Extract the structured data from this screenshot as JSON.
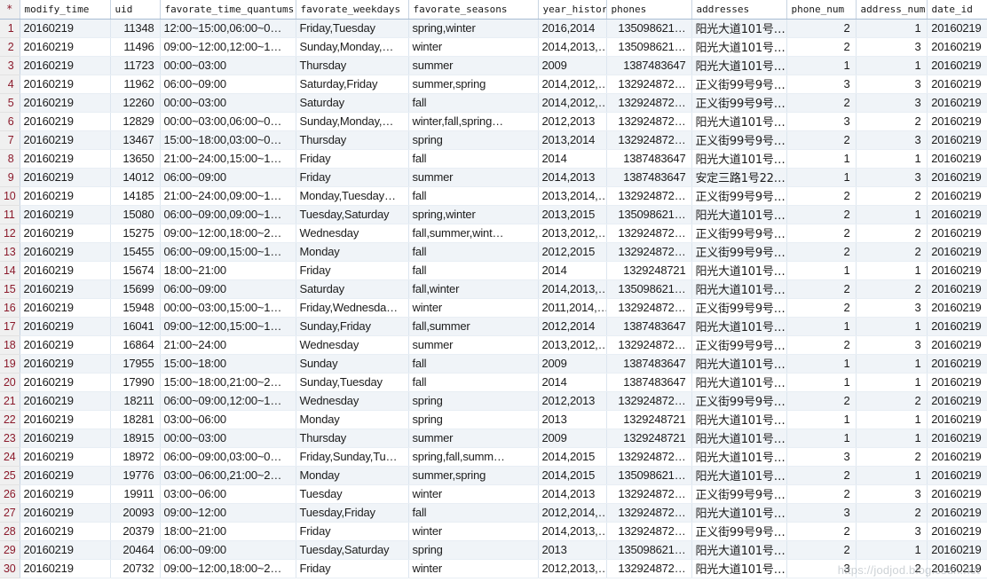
{
  "grid": {
    "row_number_header": "*",
    "watermark": "https://jodjod.blog.csdn.net",
    "columns": [
      "modify_time",
      "uid",
      "favorate_time_quantums",
      "favorate_weekdays",
      "favorate_seasons",
      "year_history",
      "phones",
      "addresses",
      "phone_num",
      "address_num",
      "date_id"
    ],
    "rows": [
      {
        "n": "1",
        "modify_time": "20160219",
        "uid": "11348",
        "favorate_time_quantums": "12:00~15:00,06:00~0…",
        "favorate_weekdays": "Friday,Tuesday",
        "favorate_seasons": "spring,winter",
        "year_history": "2016,2014",
        "phones": "135098621…",
        "addresses": "阳光大道101号…",
        "phone_num": "2",
        "address_num": "1",
        "date_id": "20160219"
      },
      {
        "n": "2",
        "modify_time": "20160219",
        "uid": "11496",
        "favorate_time_quantums": "09:00~12:00,12:00~1…",
        "favorate_weekdays": "Sunday,Monday,…",
        "favorate_seasons": "winter",
        "year_history": "2014,2013,…",
        "phones": "135098621…",
        "addresses": "阳光大道101号…",
        "phone_num": "2",
        "address_num": "3",
        "date_id": "20160219"
      },
      {
        "n": "3",
        "modify_time": "20160219",
        "uid": "11723",
        "favorate_time_quantums": "00:00~03:00",
        "favorate_weekdays": "Thursday",
        "favorate_seasons": "summer",
        "year_history": "2009",
        "phones": "1387483647",
        "addresses": "阳光大道101号…",
        "phone_num": "1",
        "address_num": "1",
        "date_id": "20160219"
      },
      {
        "n": "4",
        "modify_time": "20160219",
        "uid": "11962",
        "favorate_time_quantums": "06:00~09:00",
        "favorate_weekdays": "Saturday,Friday",
        "favorate_seasons": "summer,spring",
        "year_history": "2014,2012,…",
        "phones": "132924872…",
        "addresses": "正义街99号9号…",
        "phone_num": "3",
        "address_num": "3",
        "date_id": "20160219"
      },
      {
        "n": "5",
        "modify_time": "20160219",
        "uid": "12260",
        "favorate_time_quantums": "00:00~03:00",
        "favorate_weekdays": "Saturday",
        "favorate_seasons": "fall",
        "year_history": "2014,2012,…",
        "phones": "132924872…",
        "addresses": "正义街99号9号…",
        "phone_num": "2",
        "address_num": "3",
        "date_id": "20160219"
      },
      {
        "n": "6",
        "modify_time": "20160219",
        "uid": "12829",
        "favorate_time_quantums": "00:00~03:00,06:00~0…",
        "favorate_weekdays": "Sunday,Monday,…",
        "favorate_seasons": "winter,fall,spring…",
        "year_history": "2012,2013",
        "phones": "132924872…",
        "addresses": "阳光大道101号…",
        "phone_num": "3",
        "address_num": "2",
        "date_id": "20160219"
      },
      {
        "n": "7",
        "modify_time": "20160219",
        "uid": "13467",
        "favorate_time_quantums": "15:00~18:00,03:00~0…",
        "favorate_weekdays": "Thursday",
        "favorate_seasons": "spring",
        "year_history": "2013,2014",
        "phones": "132924872…",
        "addresses": "正义街99号9号…",
        "phone_num": "2",
        "address_num": "3",
        "date_id": "20160219"
      },
      {
        "n": "8",
        "modify_time": "20160219",
        "uid": "13650",
        "favorate_time_quantums": "21:00~24:00,15:00~1…",
        "favorate_weekdays": "Friday",
        "favorate_seasons": "fall",
        "year_history": "2014",
        "phones": "1387483647",
        "addresses": "阳光大道101号…",
        "phone_num": "1",
        "address_num": "1",
        "date_id": "20160219"
      },
      {
        "n": "9",
        "modify_time": "20160219",
        "uid": "14012",
        "favorate_time_quantums": "06:00~09:00",
        "favorate_weekdays": "Friday",
        "favorate_seasons": "summer",
        "year_history": "2014,2013",
        "phones": "1387483647",
        "addresses": "安定三路1号22…",
        "phone_num": "1",
        "address_num": "3",
        "date_id": "20160219"
      },
      {
        "n": "10",
        "modify_time": "20160219",
        "uid": "14185",
        "favorate_time_quantums": "21:00~24:00,09:00~1…",
        "favorate_weekdays": "Monday,Tuesday…",
        "favorate_seasons": "fall",
        "year_history": "2013,2014,…",
        "phones": "132924872…",
        "addresses": "正义街99号9号…",
        "phone_num": "2",
        "address_num": "2",
        "date_id": "20160219"
      },
      {
        "n": "11",
        "modify_time": "20160219",
        "uid": "15080",
        "favorate_time_quantums": "06:00~09:00,09:00~1…",
        "favorate_weekdays": "Tuesday,Saturday",
        "favorate_seasons": "spring,winter",
        "year_history": "2013,2015",
        "phones": "135098621…",
        "addresses": "阳光大道101号…",
        "phone_num": "2",
        "address_num": "1",
        "date_id": "20160219"
      },
      {
        "n": "12",
        "modify_time": "20160219",
        "uid": "15275",
        "favorate_time_quantums": "09:00~12:00,18:00~2…",
        "favorate_weekdays": "Wednesday",
        "favorate_seasons": "fall,summer,wint…",
        "year_history": "2013,2012,…",
        "phones": "132924872…",
        "addresses": "正义街99号9号…",
        "phone_num": "2",
        "address_num": "2",
        "date_id": "20160219"
      },
      {
        "n": "13",
        "modify_time": "20160219",
        "uid": "15455",
        "favorate_time_quantums": "06:00~09:00,15:00~1…",
        "favorate_weekdays": "Monday",
        "favorate_seasons": "fall",
        "year_history": "2012,2015",
        "phones": "132924872…",
        "addresses": "正义街99号9号…",
        "phone_num": "2",
        "address_num": "2",
        "date_id": "20160219"
      },
      {
        "n": "14",
        "modify_time": "20160219",
        "uid": "15674",
        "favorate_time_quantums": "18:00~21:00",
        "favorate_weekdays": "Friday",
        "favorate_seasons": "fall",
        "year_history": "2014",
        "phones": "1329248721",
        "addresses": "阳光大道101号…",
        "phone_num": "1",
        "address_num": "1",
        "date_id": "20160219"
      },
      {
        "n": "15",
        "modify_time": "20160219",
        "uid": "15699",
        "favorate_time_quantums": "06:00~09:00",
        "favorate_weekdays": "Saturday",
        "favorate_seasons": "fall,winter",
        "year_history": "2014,2013,…",
        "phones": "135098621…",
        "addresses": "阳光大道101号…",
        "phone_num": "2",
        "address_num": "2",
        "date_id": "20160219"
      },
      {
        "n": "16",
        "modify_time": "20160219",
        "uid": "15948",
        "favorate_time_quantums": "00:00~03:00,15:00~1…",
        "favorate_weekdays": "Friday,Wednesda…",
        "favorate_seasons": "winter",
        "year_history": "2011,2014,…",
        "phones": "132924872…",
        "addresses": "正义街99号9号…",
        "phone_num": "2",
        "address_num": "3",
        "date_id": "20160219"
      },
      {
        "n": "17",
        "modify_time": "20160219",
        "uid": "16041",
        "favorate_time_quantums": "09:00~12:00,15:00~1…",
        "favorate_weekdays": "Sunday,Friday",
        "favorate_seasons": "fall,summer",
        "year_history": "2012,2014",
        "phones": "1387483647",
        "addresses": "阳光大道101号…",
        "phone_num": "1",
        "address_num": "1",
        "date_id": "20160219"
      },
      {
        "n": "18",
        "modify_time": "20160219",
        "uid": "16864",
        "favorate_time_quantums": "21:00~24:00",
        "favorate_weekdays": "Wednesday",
        "favorate_seasons": "summer",
        "year_history": "2013,2012,…",
        "phones": "132924872…",
        "addresses": "正义街99号9号…",
        "phone_num": "2",
        "address_num": "3",
        "date_id": "20160219"
      },
      {
        "n": "19",
        "modify_time": "20160219",
        "uid": "17955",
        "favorate_time_quantums": "15:00~18:00",
        "favorate_weekdays": "Sunday",
        "favorate_seasons": "fall",
        "year_history": "2009",
        "phones": "1387483647",
        "addresses": "阳光大道101号…",
        "phone_num": "1",
        "address_num": "1",
        "date_id": "20160219"
      },
      {
        "n": "20",
        "modify_time": "20160219",
        "uid": "17990",
        "favorate_time_quantums": "15:00~18:00,21:00~2…",
        "favorate_weekdays": "Sunday,Tuesday",
        "favorate_seasons": "fall",
        "year_history": "2014",
        "phones": "1387483647",
        "addresses": "阳光大道101号…",
        "phone_num": "1",
        "address_num": "1",
        "date_id": "20160219"
      },
      {
        "n": "21",
        "modify_time": "20160219",
        "uid": "18211",
        "favorate_time_quantums": "06:00~09:00,12:00~1…",
        "favorate_weekdays": "Wednesday",
        "favorate_seasons": "spring",
        "year_history": "2012,2013",
        "phones": "132924872…",
        "addresses": "正义街99号9号…",
        "phone_num": "2",
        "address_num": "2",
        "date_id": "20160219"
      },
      {
        "n": "22",
        "modify_time": "20160219",
        "uid": "18281",
        "favorate_time_quantums": "03:00~06:00",
        "favorate_weekdays": "Monday",
        "favorate_seasons": "spring",
        "year_history": "2013",
        "phones": "1329248721",
        "addresses": "阳光大道101号…",
        "phone_num": "1",
        "address_num": "1",
        "date_id": "20160219"
      },
      {
        "n": "23",
        "modify_time": "20160219",
        "uid": "18915",
        "favorate_time_quantums": "00:00~03:00",
        "favorate_weekdays": "Thursday",
        "favorate_seasons": "summer",
        "year_history": "2009",
        "phones": "1329248721",
        "addresses": "阳光大道101号…",
        "phone_num": "1",
        "address_num": "1",
        "date_id": "20160219"
      },
      {
        "n": "24",
        "modify_time": "20160219",
        "uid": "18972",
        "favorate_time_quantums": "06:00~09:00,03:00~0…",
        "favorate_weekdays": "Friday,Sunday,Tu…",
        "favorate_seasons": "spring,fall,summ…",
        "year_history": "2014,2015",
        "phones": "132924872…",
        "addresses": "阳光大道101号…",
        "phone_num": "3",
        "address_num": "2",
        "date_id": "20160219"
      },
      {
        "n": "25",
        "modify_time": "20160219",
        "uid": "19776",
        "favorate_time_quantums": "03:00~06:00,21:00~2…",
        "favorate_weekdays": "Monday",
        "favorate_seasons": "summer,spring",
        "year_history": "2014,2015",
        "phones": "135098621…",
        "addresses": "阳光大道101号…",
        "phone_num": "2",
        "address_num": "1",
        "date_id": "20160219"
      },
      {
        "n": "26",
        "modify_time": "20160219",
        "uid": "19911",
        "favorate_time_quantums": "03:00~06:00",
        "favorate_weekdays": "Tuesday",
        "favorate_seasons": "winter",
        "year_history": "2014,2013",
        "phones": "132924872…",
        "addresses": "正义街99号9号…",
        "phone_num": "2",
        "address_num": "3",
        "date_id": "20160219"
      },
      {
        "n": "27",
        "modify_time": "20160219",
        "uid": "20093",
        "favorate_time_quantums": "09:00~12:00",
        "favorate_weekdays": "Tuesday,Friday",
        "favorate_seasons": "fall",
        "year_history": "2012,2014,…",
        "phones": "132924872…",
        "addresses": "阳光大道101号…",
        "phone_num": "3",
        "address_num": "2",
        "date_id": "20160219"
      },
      {
        "n": "28",
        "modify_time": "20160219",
        "uid": "20379",
        "favorate_time_quantums": "18:00~21:00",
        "favorate_weekdays": "Friday",
        "favorate_seasons": "winter",
        "year_history": "2014,2013,…",
        "phones": "132924872…",
        "addresses": "正义街99号9号…",
        "phone_num": "2",
        "address_num": "3",
        "date_id": "20160219"
      },
      {
        "n": "29",
        "modify_time": "20160219",
        "uid": "20464",
        "favorate_time_quantums": "06:00~09:00",
        "favorate_weekdays": "Tuesday,Saturday",
        "favorate_seasons": "spring",
        "year_history": "2013",
        "phones": "135098621…",
        "addresses": "阳光大道101号…",
        "phone_num": "2",
        "address_num": "1",
        "date_id": "20160219"
      },
      {
        "n": "30",
        "modify_time": "20160219",
        "uid": "20732",
        "favorate_time_quantums": "09:00~12:00,18:00~2…",
        "favorate_weekdays": "Friday",
        "favorate_seasons": "winter",
        "year_history": "2012,2013,…",
        "phones": "132924872…",
        "addresses": "阳光大道101号…",
        "phone_num": "3",
        "address_num": "2",
        "date_id": "20160219"
      }
    ]
  }
}
